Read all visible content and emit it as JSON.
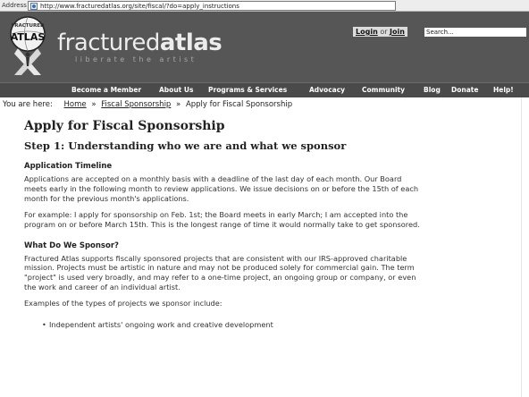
{
  "browser": {
    "address_label": "Address",
    "url": "http://www.fracturedatlas.org/site/fiscal/?do=apply_instructions"
  },
  "header": {
    "logo_top": "FRACTURED",
    "logo_main": "ATLAS",
    "brand_light": "fractured",
    "brand_bold": "atlas",
    "tagline": "liberate the artist",
    "login_label": "Login",
    "or_label": "or",
    "join_label": "Join",
    "search_placeholder": "Search..."
  },
  "nav": {
    "items": [
      "Become a Member",
      "About Us",
      "Programs & Services",
      "Advocacy",
      "Community",
      "Blog",
      "Donate",
      "Help!"
    ]
  },
  "breadcrumb": {
    "label": "You are here:",
    "home": "Home",
    "section": "Fiscal Sponsorship",
    "current": "Apply for Fiscal Sponsorship",
    "separator": "»"
  },
  "main": {
    "title": "Apply for Fiscal Sponsorship",
    "step": "Step 1: Understanding who we are and what we sponsor",
    "timeline_heading": "Application Timeline",
    "timeline_p1": "Applications are accepted on a monthly basis with a deadline of the last day of each month. Our Board meets early in the following month to review applications. We issue decisions on or before the 15th of each month for the previous month's applications.",
    "timeline_p2": "For example: I apply for sponsorship on Feb. 1st; the Board meets in early March; I am accepted into the program on or before March 15th. This is the longest range of time it would normally take to get sponsored.",
    "sponsor_heading": "What Do We Sponsor?",
    "sponsor_p1": "Fractured Atlas supports fiscally sponsored projects that are consistent with our IRS-approved charitable mission. Projects must be artistic in nature and may not be produced solely for commercial gain. The term \"project\" is used very broadly, and may refer to a one-time project, an ongoing group or company, or even the work and career of an individual artist.",
    "sponsor_p2": "Examples of the types of projects we sponsor include:",
    "list": [
      "Independent artists' ongoing work and creative development"
    ]
  }
}
